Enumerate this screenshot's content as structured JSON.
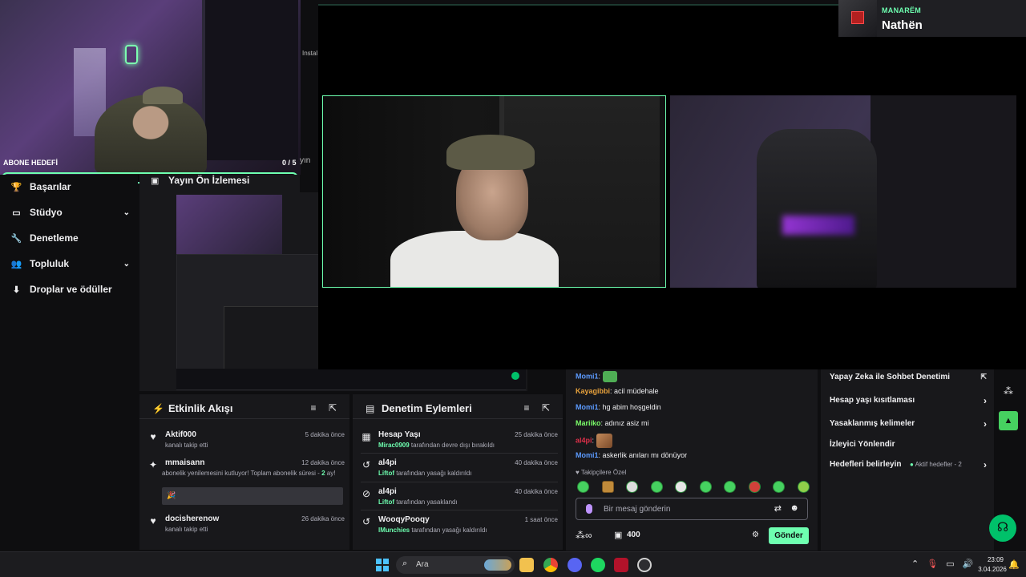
{
  "webcam": {
    "goal_label": "ABONE HEDEFİ",
    "goal_count": "0 / 5"
  },
  "nav": {
    "items": [
      {
        "label": "Başarılar",
        "icon": "trophy-icon"
      },
      {
        "label": "Stüdyo",
        "icon": "studio-icon"
      },
      {
        "label": "Denetleme",
        "icon": "wrench-icon"
      },
      {
        "label": "Topluluk",
        "icon": "community-icon"
      },
      {
        "label": "Droplar ve ödüller",
        "icon": "drops-icon"
      }
    ]
  },
  "preview": {
    "title": "Yayın Ön İzlemesi",
    "mini_instal": "Instal",
    "mini_yin": "yın"
  },
  "streamer": {
    "team": "MANARËM",
    "name": "Nathën"
  },
  "events": {
    "title": "Etkinlik Akışı",
    "items": [
      {
        "name": "Aktif000",
        "time": "5 dakika önce",
        "text": "kanalı takip etti"
      },
      {
        "name": "mmaisann",
        "time": "12 dakika önce",
        "text_before": "abonelik yenilemesini kutluyor! Toplam abonelik süresi - ",
        "months": "2",
        "text_after": "ay!"
      },
      {
        "name": "docisherenow",
        "time": "26 dakika önce",
        "text": "kanalı takip etti"
      }
    ]
  },
  "mod": {
    "title": "Denetim Eylemleri",
    "items": [
      {
        "name": "Hesap Yaşı",
        "time": "25 dakika önce",
        "actor": "Mirac0909",
        "text": " tarafından devre dışı bırakıldı"
      },
      {
        "name": "al4pi",
        "time": "40 dakika önce",
        "actor": "Liftof",
        "text": " tarafından yasağı kaldırıldı"
      },
      {
        "name": "al4pi",
        "time": "40 dakika önce",
        "actor": "Liftof",
        "text": " tarafından yasaklandı"
      },
      {
        "name": "WooqyPooqy",
        "time": "1 saat önce",
        "actor": "lMunchies",
        "text": " tarafından yasağı kaldırıldı"
      }
    ]
  },
  "chat": {
    "messages": [
      {
        "user": "Momi1",
        "color": "#5c9bff",
        "text": ""
      },
      {
        "user": "Kayagibbi",
        "color": "#e8a23c",
        "text": "acil müdehale"
      },
      {
        "user": "Momi1",
        "color": "#5c9bff",
        "text": "hg abim hoşgeldin"
      },
      {
        "user": "Mariiko",
        "color": "#7cff6a",
        "text": "adınız asiz mi"
      },
      {
        "user": "al4pi",
        "color": "#e0304a",
        "text": ""
      },
      {
        "user": "Momi1",
        "color": "#5c9bff",
        "text": "askerlik anıları mı dönüyor"
      }
    ],
    "sub_only": "Takipçilere Özel",
    "placeholder": "Bir mesaj gönderin",
    "points": "400",
    "send": "Gönder"
  },
  "settings": {
    "items": [
      {
        "label": "Yapay Zeka ile Sohbet Denetimi"
      },
      {
        "label": "Hesap yaşı kısıtlaması"
      },
      {
        "label": "Yasaklanmış kelimeler"
      },
      {
        "label": "İzleyici Yönlendir"
      },
      {
        "label": "Hedefleri belirleyin",
        "meta": "Aktif hedefler - 2"
      }
    ]
  },
  "taskbar": {
    "search": "Ara",
    "time": "23:09",
    "date": "3.04.2026"
  }
}
